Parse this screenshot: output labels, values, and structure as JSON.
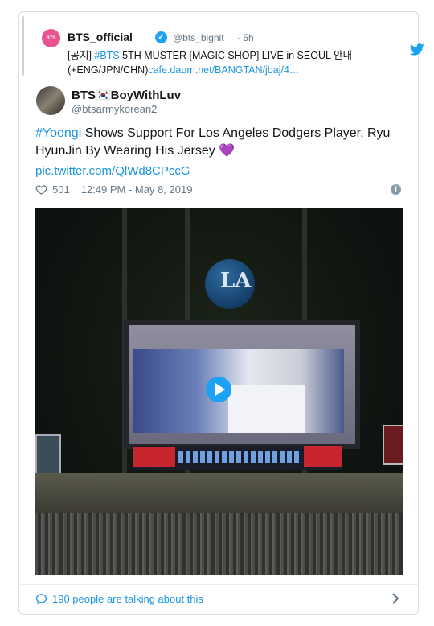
{
  "quoted": {
    "avatar_text": "BTS",
    "name": "BTS_official",
    "handle": "@bts_bighit",
    "time": "· 5h",
    "text_prefix": "[공지] ",
    "hashtag": "#BTS",
    "text_main": " 5TH MUSTER [MAGIC SHOP] LIVE in SEOUL 안내 (+ENG/JPN/CHN)",
    "link": "cafe.daum.net/BANGTAN/jbaj/4…"
  },
  "account": {
    "name": "BTS🇰🇷BoyWithLuv",
    "handle": "@btsarmykorean2"
  },
  "tweet": {
    "hashtag": "#Yoongi",
    "text": " Shows Support For Los Angeles Dodgers Player, Ryu HyunJin By Wearing His Jersey ",
    "emoji": "💜",
    "pic_link": "pic.twitter.com/QlWd8CPccG"
  },
  "meta": {
    "likes": "501",
    "timestamp": "12:49 PM - May 8, 2019"
  },
  "video": {
    "logo_text": "LA"
  },
  "footer": {
    "talking": "190 people are talking about this"
  },
  "colors": {
    "link": "#1b95e0",
    "twitter_blue": "#1da1f2",
    "muted": "#657786"
  }
}
